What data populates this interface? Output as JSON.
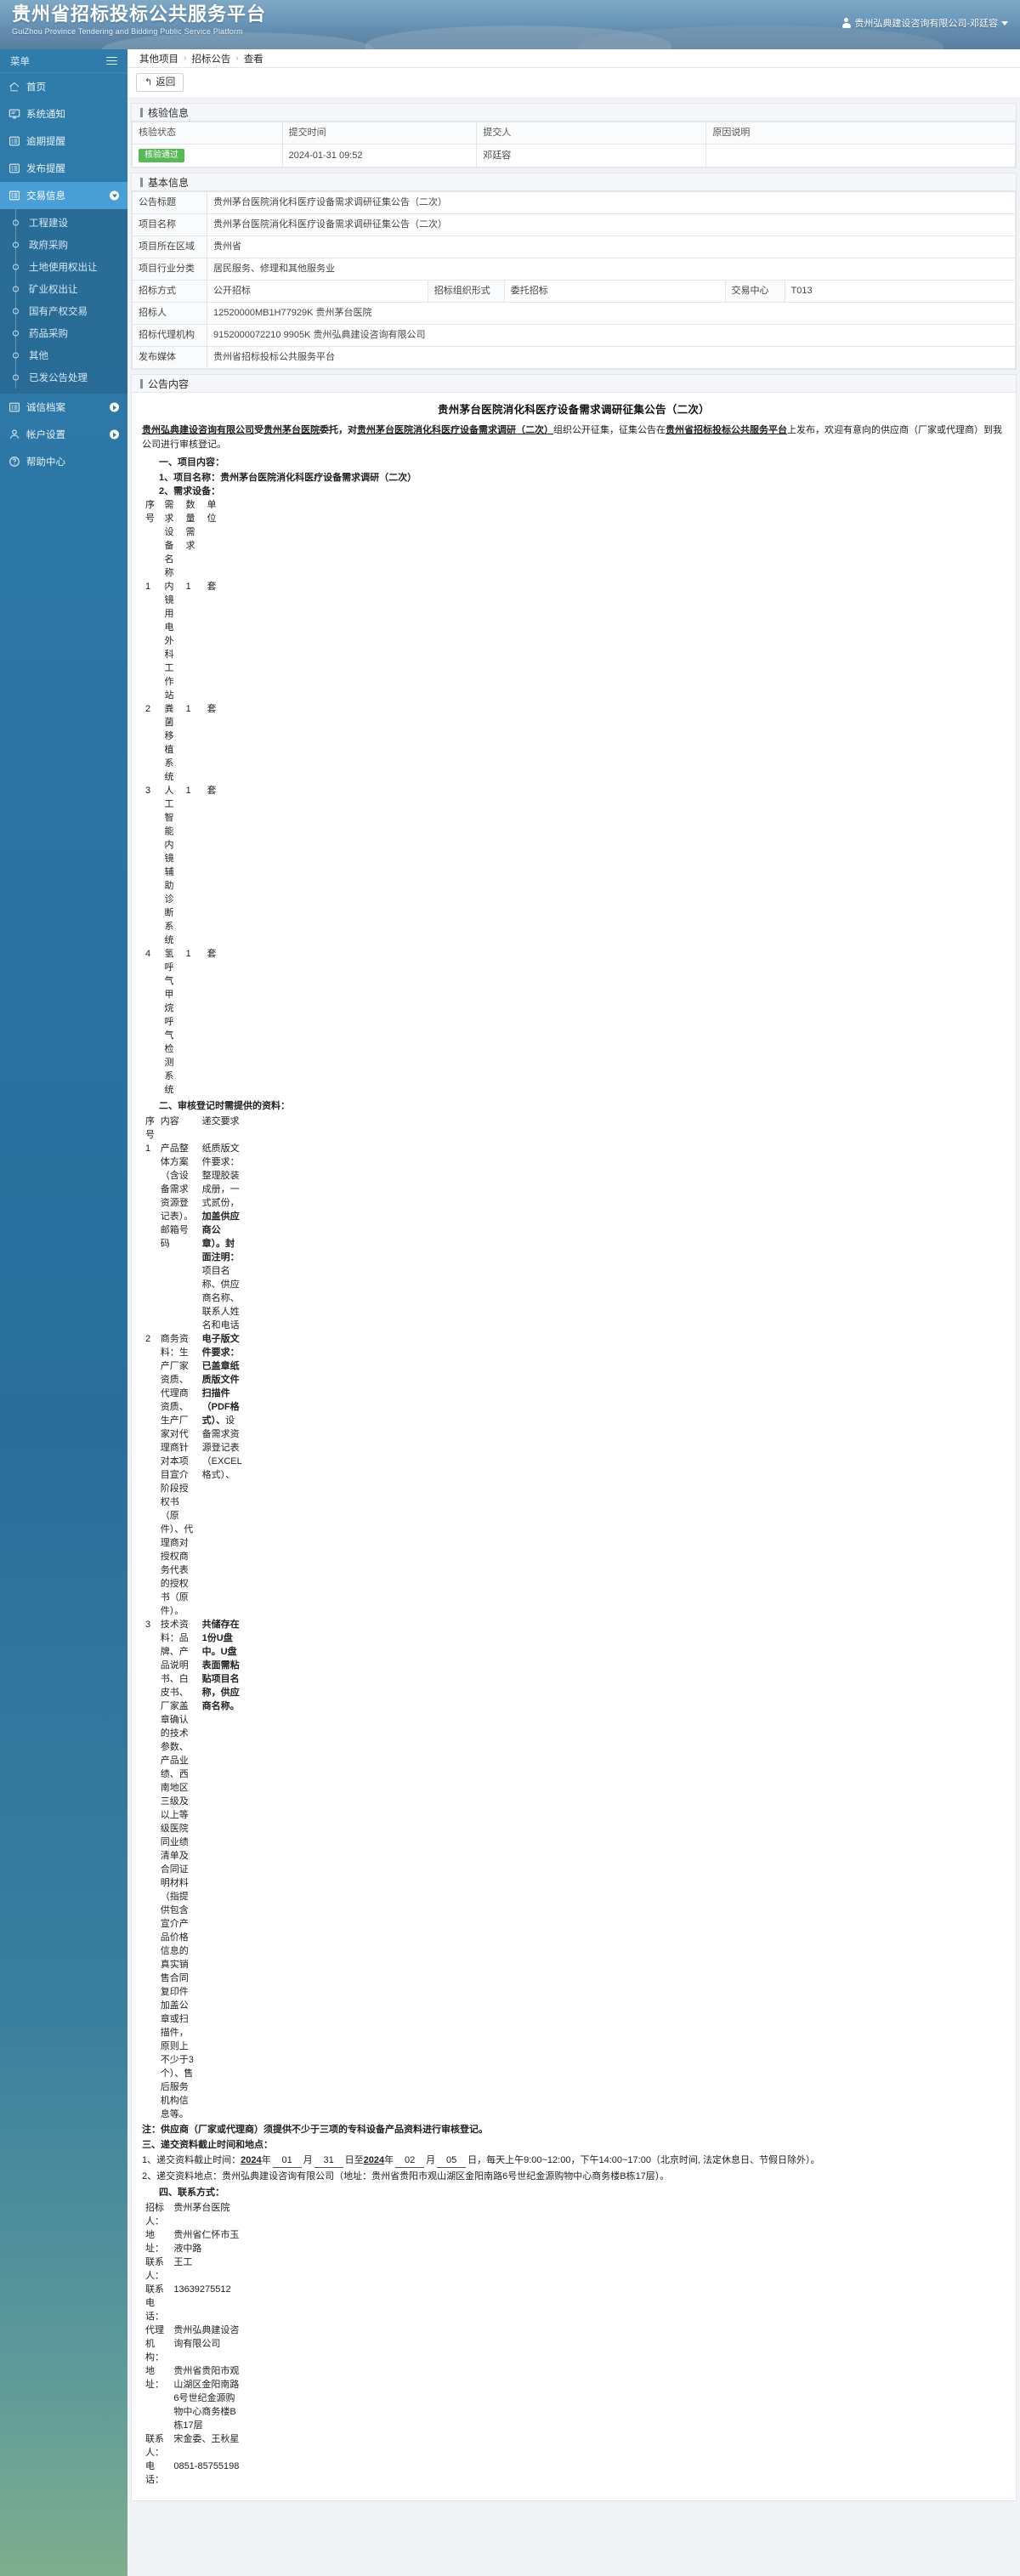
{
  "header": {
    "title_cn": "贵州省招标投标公共服务平台",
    "title_en": "GuiZhou Province Tendering and Bidding Public Service Platform",
    "user": "贵州弘典建设咨询有限公司-邓廷容"
  },
  "sidebar": {
    "menu_label": "菜单",
    "items": [
      {
        "label": "首页",
        "icon": "home-icon",
        "arrow": ""
      },
      {
        "label": "系统通知",
        "icon": "monitor-icon",
        "arrow": ""
      },
      {
        "label": "逾期提醒",
        "icon": "list-icon",
        "arrow": ""
      },
      {
        "label": "发布提醒",
        "icon": "list-icon",
        "arrow": ""
      },
      {
        "label": "交易信息",
        "icon": "list-icon",
        "arrow": "down"
      }
    ],
    "submenu": [
      "工程建设",
      "政府采购",
      "土地使用权出让",
      "矿业权出让",
      "国有产权交易",
      "药品采购",
      "其他",
      "已发公告处理"
    ],
    "items_bottom": [
      {
        "label": "诚信档案",
        "icon": "list-icon",
        "arrow": "right"
      },
      {
        "label": "帐户设置",
        "icon": "user-icon",
        "arrow": "right"
      },
      {
        "label": "帮助中心",
        "icon": "question-icon",
        "arrow": ""
      }
    ]
  },
  "breadcrumb": {
    "items": [
      "其他项目",
      "招标公告",
      "查看"
    ],
    "separator": "›"
  },
  "toolbar": {
    "back_label": "返回",
    "back_icon": "undo-arrow-icon"
  },
  "verify_panel": {
    "title": "核验信息",
    "headers": [
      "核验状态",
      "提交时间",
      "提交人",
      "原因说明"
    ],
    "rows": [
      {
        "status": "核验通过",
        "time": "2024-01-31 09:52",
        "person": "邓廷容",
        "reason": ""
      }
    ],
    "status_color": "#58b957"
  },
  "basic_panel": {
    "title": "基本信息",
    "fields": {
      "notice_title_label": "公告标题",
      "notice_title_value": "贵州茅台医院消化科医疗设备需求调研征集公告（二次）",
      "project_name_label": "项目名称",
      "project_name_value": "贵州茅台医院消化科医疗设备需求调研征集公告（二次）",
      "region_label": "项目所在区域",
      "region_value": "贵州省",
      "industry_label": "项目行业分类",
      "industry_value": "居民服务、修理和其他服务业",
      "bid_method_label": "招标方式",
      "bid_method_value": "公开招标",
      "org_form_label": "招标组织形式",
      "org_form_value": "委托招标",
      "center_label": "交易中心",
      "center_value": "T013",
      "tenderer_label": "招标人",
      "tenderer_value": "12520000MB1H77929K 贵州茅台医院",
      "agency_label": "招标代理机构",
      "agency_value": "9152000072210 9905K 贵州弘典建设咨询有限公司",
      "media_label": "发布媒体",
      "media_value": "贵州省招标投标公共服务平台"
    }
  },
  "content_panel": {
    "title": "公告内容",
    "doc_title": "贵州茅台医院消化科医疗设备需求调研征集公告（二次）",
    "lead": {
      "p1": "贵州弘典建设咨询有限公司",
      "p2": "受",
      "p3": "贵州茅台医院",
      "p4": "委托，对",
      "p5": "贵州茅台医院消化科医疗设备需求调研（二次）",
      "p6": "组织公开征集，征集公告在",
      "p7": "贵州省招标投标公共服务平台",
      "p8": "上发布，欢迎有意向的供应商（厂家或代理商）到我公司进行审核登记。"
    },
    "s1_title": "一、项目内容：",
    "s1_line1": "1、项目名称：贵州茅台医院消化科医疗设备需求调研（二次）",
    "s1_line2": "2、需求设备：",
    "table1": {
      "headers": [
        "序号",
        "需求设备名称",
        "数量需求",
        "单位"
      ],
      "rows": [
        {
          "no": "1",
          "name": "内镜用电外科工作站",
          "qty": "1",
          "unit": "套"
        },
        {
          "no": "2",
          "name": "粪菌移植系统",
          "qty": "1",
          "unit": "套"
        },
        {
          "no": "3",
          "name": "人工智能内镜辅助诊断系统",
          "qty": "1",
          "unit": "套"
        },
        {
          "no": "4",
          "name": "氢呼气甲烷呼气检测系统",
          "qty": "1",
          "unit": "套"
        }
      ]
    },
    "s2_title": "二、审核登记时需提供的资料：",
    "table2": {
      "headers": [
        "序号",
        "内容",
        "递交要求"
      ],
      "rows": [
        {
          "no": "1",
          "content": "产品整体方案（含设备需求资源登记表）。邮箱号码",
          "req_a": "纸质版文件要求：整理胶装成册，一式贰份，",
          "req_b": "加盖供应商公章）。封面注明：",
          "req_c": "项目名称、供应商名称、联系人姓名和电话"
        },
        {
          "no": "2",
          "content": "商务资料：生产厂家资质、代理商资质、生产厂家对代理商针对本项目宣介阶段授权书（原件）、代理商对授权商务代表的授权书（原件）。",
          "req_a": "",
          "req_b": "电子版文件要求：已盖章纸质版文件扫描件（PDF格式）、",
          "req_c": "设备需求资源登记表（EXCEL格式）、"
        },
        {
          "no": "3",
          "content": "技术资料：品牌、产品说明书、白皮书、厂家盖章确认的技术参数、产品业绩、西南地区三级及以上等级医院同业绩清单及合同证明材料（指提供包含宣介产品价格信息的真实销售合同复印件加盖公章或扫描件，原则上不少于3个）、售后服务机构信息等。",
          "req_a": "",
          "req_b": "共储存在1份U盘中。U盘表面需粘贴项目名称，供应商名称。",
          "req_c": ""
        }
      ]
    },
    "note": "注：供应商（厂家或代理商）须提供不少于三项的专科设备产品资料进行审核登记。",
    "s3_title": "三、递交资料截止时间和地点：",
    "s3_line1_a": "1、递交资料截止时间：",
    "s3_y1": "2024",
    "s3_y1u": "年",
    "s3_m1": "01",
    "s3_m1u": "月",
    "s3_d1": "31",
    "s3_d1u": "日至",
    "s3_y2": "2024",
    "s3_y2u": "年",
    "s3_m2": "02",
    "s3_m2u": "月",
    "s3_d2": "05",
    "s3_d2u": "日，",
    "s3_line1_b": "每天上午9:00~12:00，下午14:00~17:00（北京时间, 法定休息日、节假日除外）。",
    "s3_line2": "2、递交资料地点：贵州弘典建设咨询有限公司（地址：贵州省贵阳市观山湖区金阳南路6号世纪金源购物中心商务楼B栋17层）。",
    "s4_title": "四、联系方式：",
    "contact": {
      "rows": [
        {
          "label": "招标人：",
          "value": "贵州茅台医院"
        },
        {
          "label": "地址：",
          "value": "贵州省仁怀市玉液中路"
        },
        {
          "label": "联系人：",
          "value": "王工"
        },
        {
          "label": "联系电话：",
          "value": "13639275512"
        },
        {
          "label": "代理机构：",
          "value": "贵州弘典建设咨询有限公司"
        },
        {
          "label": "地址：",
          "value": "贵州省贵阳市观山湖区金阳南路6号世纪金源购物中心商务楼B栋17层"
        },
        {
          "label": "联系人：",
          "value": "宋金委、王秋星"
        },
        {
          "label": "电话：",
          "value": "0851-85755198"
        }
      ]
    }
  }
}
